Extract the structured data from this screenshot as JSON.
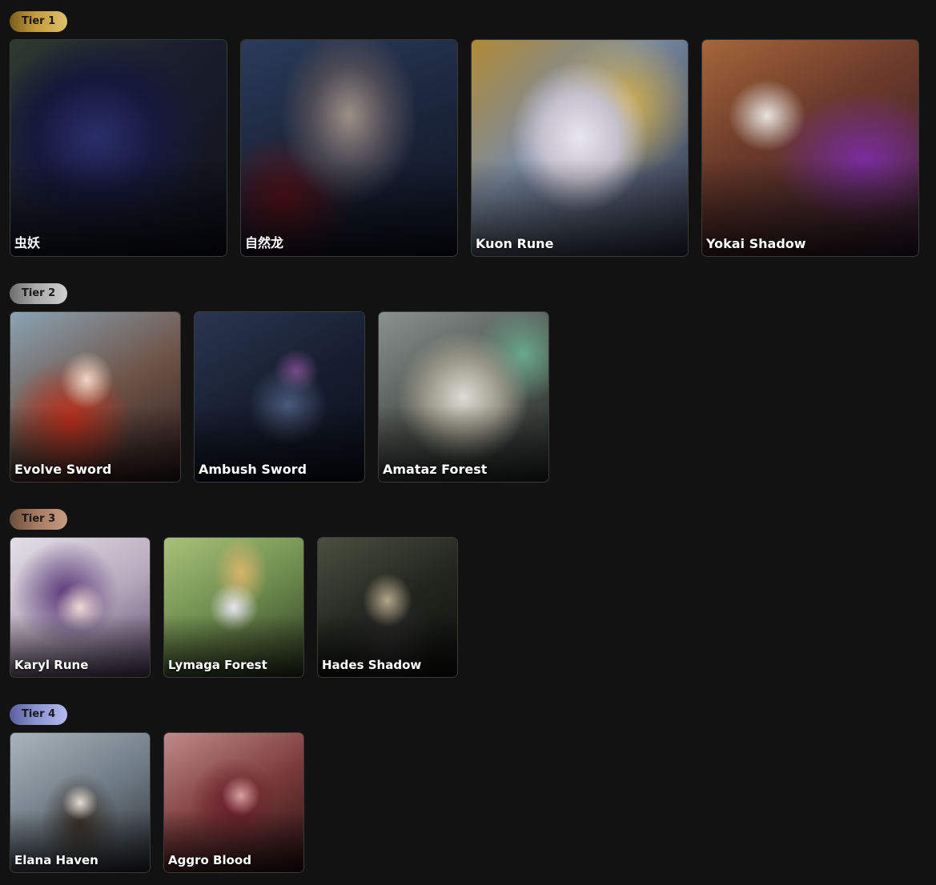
{
  "tiers": [
    {
      "label": "Tier 1",
      "color": "#c59b3c",
      "decks": [
        "虫妖",
        "自然龙",
        "Kuon Rune",
        "Yokai Shadow"
      ]
    },
    {
      "label": "Tier 2",
      "color": "#a9a9a9",
      "decks": [
        "Evolve Sword",
        "Ambush Sword",
        "Amataz Forest"
      ]
    },
    {
      "label": "Tier 3",
      "color": "#a57a60",
      "decks": [
        "Karyl Rune",
        "Lymaga Forest",
        "Hades Shadow"
      ]
    },
    {
      "label": "Tier 4",
      "color": "#8b92d1",
      "decks": [
        "Elana Haven",
        "Aggro Blood"
      ]
    }
  ]
}
